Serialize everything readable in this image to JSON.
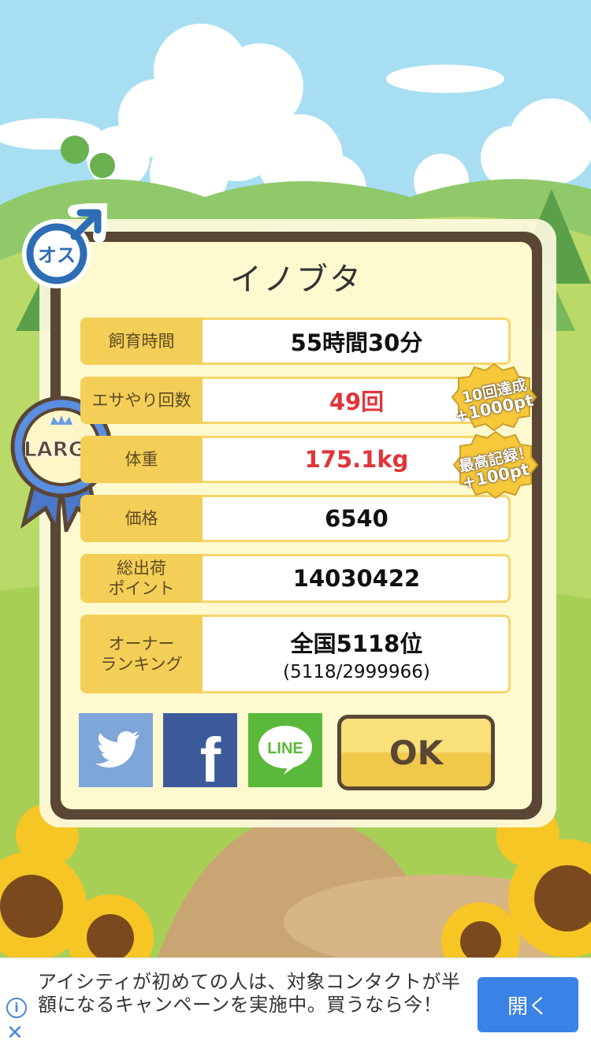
{
  "pig": {
    "name": "イノブタ",
    "gender_badge": "オス",
    "size_ribbon": "LARGE"
  },
  "stats": [
    {
      "label": "飼育時間",
      "value": "55時間30分",
      "highlight": false
    },
    {
      "label": "エサやり回数",
      "value": "49回",
      "highlight": true
    },
    {
      "label": "体重",
      "value": "175.1kg",
      "highlight": true
    },
    {
      "label": "価格",
      "value": "6540",
      "highlight": false
    },
    {
      "label": "総出荷\nポイント",
      "value": "14030422",
      "highlight": false
    },
    {
      "label": "オーナー\nランキング",
      "value": "全国5118位",
      "sub": "(5118/2999966)",
      "highlight": false
    }
  ],
  "bonuses": [
    {
      "line1": "10回達成",
      "line2": "+1000pt"
    },
    {
      "line1": "最高記録！",
      "line2": "+100pt"
    }
  ],
  "share": {
    "twitter_icon": "twitter-bird-icon",
    "facebook_label": "f",
    "line_label": "LINE"
  },
  "ok_button": "OK",
  "ad": {
    "text": "アイシティが初めての人は、対象コンタクトが半額になるキャンペーンを実施中。買うなら今！",
    "button": "開く",
    "info_icon": "i",
    "close_icon": "✕"
  },
  "colors": {
    "frame": "#5a4634",
    "label_bg": "#f4cf57",
    "highlight_text": "#e0353a",
    "ad_button": "#3b82e6"
  }
}
